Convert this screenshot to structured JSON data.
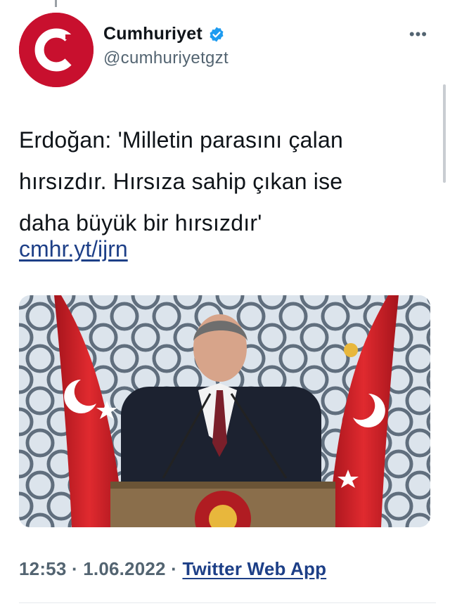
{
  "account": {
    "display_name": "Cumhuriyet",
    "handle": "@cumhuriyetgzt",
    "verified": true,
    "avatar_letter": "C",
    "avatar_color": "#c8102e"
  },
  "tweet": {
    "text_lines": [
      "Erdoğan: 'Milletin parasını çalan",
      "hırsızdır. Hırsıza sahip çıkan ise",
      "daha büyük bir hırsızdır'"
    ],
    "link": "cmhr.yt/ijrn",
    "time": "12:53",
    "date": "1.06.2022",
    "separator": "·",
    "source": "Twitter Web App"
  },
  "icons": {
    "more": "more-horizontal-icon",
    "verified": "verified-badge-icon"
  },
  "colors": {
    "link": "#1d3f87",
    "muted": "#536471",
    "verified": "#1d9bf0",
    "flag_red": "#d4242b"
  }
}
